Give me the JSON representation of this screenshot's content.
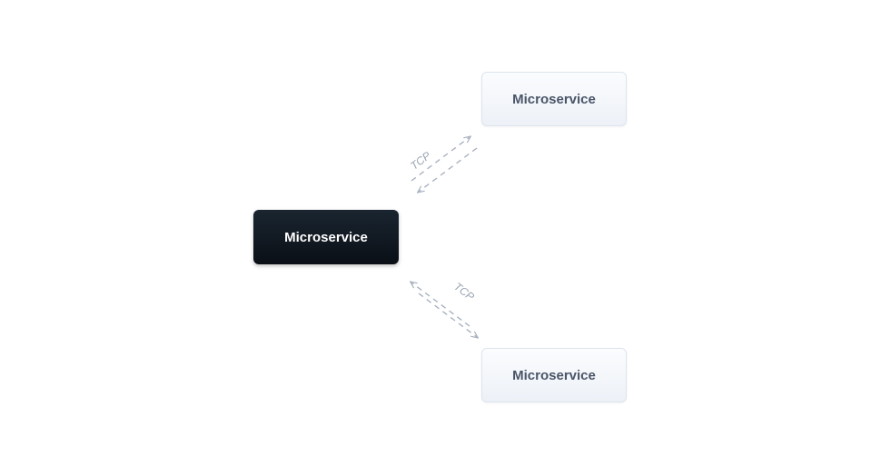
{
  "nodes": {
    "left": {
      "label": "Microservice"
    },
    "topRight": {
      "label": "Microservice"
    },
    "bottomRight": {
      "label": "Microservice"
    }
  },
  "connectors": {
    "top": {
      "label": "TCP"
    },
    "bottom": {
      "label": "TCP"
    }
  },
  "colors": {
    "darkNodeGradientTop": "#1a2530",
    "darkNodeGradientBottom": "#0a0f16",
    "lightNodeGradientTop": "#fbfcfe",
    "lightNodeGradientBottom": "#edf1f7",
    "lightNodeBorder": "#dde5ee",
    "lightNodeText": "#4a5568",
    "arrowStroke": "#a9b2c0",
    "labelText": "#9aa4b2"
  }
}
